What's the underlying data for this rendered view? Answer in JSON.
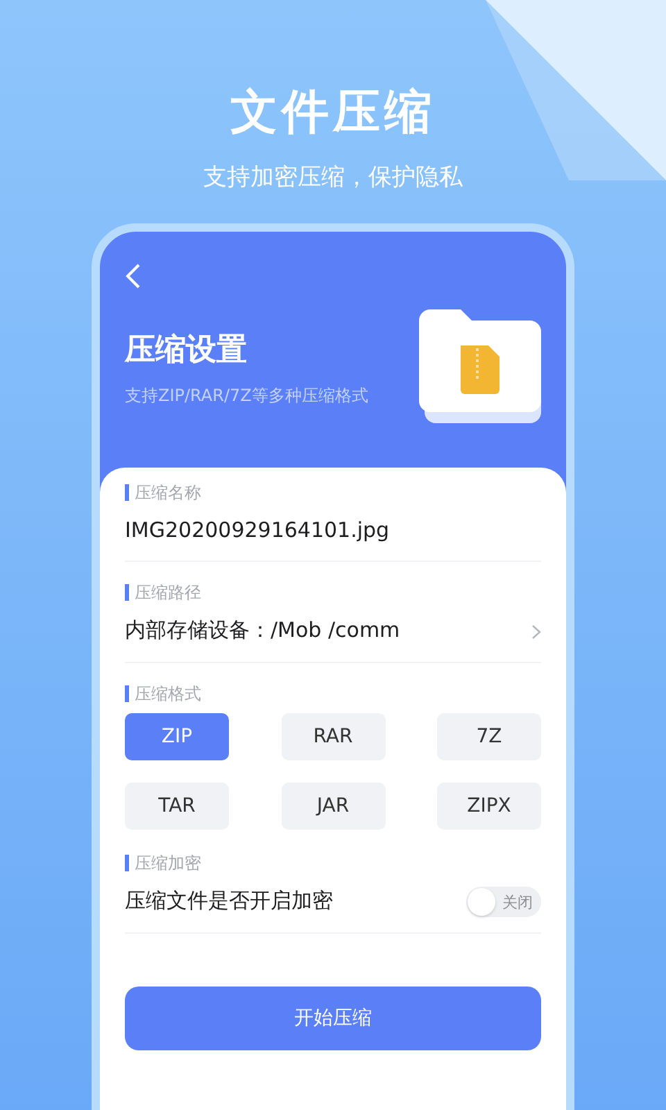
{
  "promo": {
    "title": "文件压缩",
    "subtitle": "支持加密压缩，保护隐私"
  },
  "header": {
    "title": "压缩设置",
    "subtitle": "支持ZIP/RAR/7Z等多种压缩格式"
  },
  "name_section": {
    "label": "压缩名称",
    "value": "IMG20200929164101.jpg"
  },
  "path_section": {
    "label": "压缩路径",
    "value": "内部存储设备：/Mob /comm"
  },
  "format_section": {
    "label": "压缩格式",
    "formats": [
      {
        "label": "ZIP",
        "selected": true
      },
      {
        "label": "RAR",
        "selected": false
      },
      {
        "label": "7Z",
        "selected": false
      },
      {
        "label": "TAR",
        "selected": false
      },
      {
        "label": "JAR",
        "selected": false
      },
      {
        "label": "ZIPX",
        "selected": false
      }
    ]
  },
  "encrypt_section": {
    "label": "压缩加密",
    "text": "压缩文件是否开启加密",
    "toggle": {
      "on": false,
      "label": "关闭"
    }
  },
  "start_button": "开始压缩"
}
